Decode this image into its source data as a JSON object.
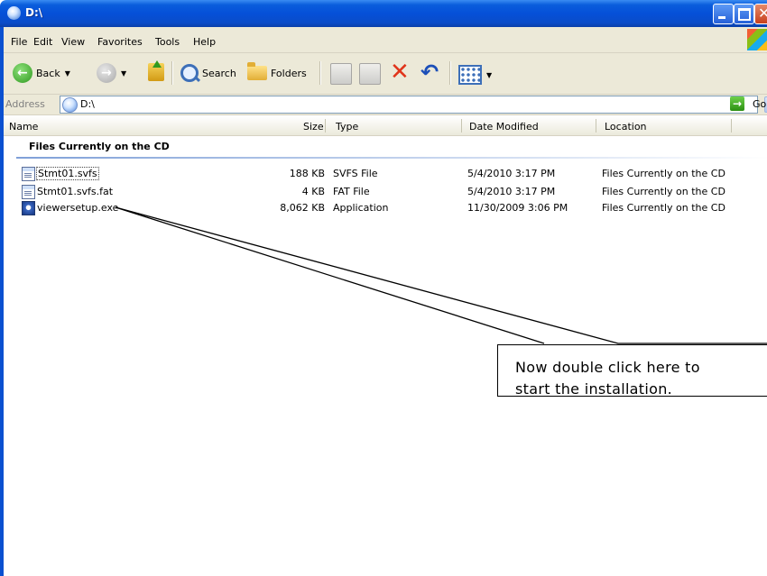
{
  "window": {
    "title": "D:\\",
    "colors": {
      "titlebar": "#0a5ddc",
      "chrome": "#ece9d8",
      "close": "#c8401c"
    }
  },
  "menu": {
    "items": [
      "File",
      "Edit",
      "View",
      "Favorites",
      "Tools",
      "Help"
    ]
  },
  "toolbar": {
    "back_label": "Back",
    "search_label": "Search",
    "folders_label": "Folders"
  },
  "address": {
    "label": "Address",
    "value": "D:\\",
    "go_label": "Go"
  },
  "columns": {
    "name": "Name",
    "size": "Size",
    "type": "Type",
    "date": "Date Modified",
    "location": "Location"
  },
  "group": {
    "title": "Files Currently on the CD"
  },
  "files": [
    {
      "name": "Stmt01.svfs",
      "size": "188 KB",
      "type": "SVFS File",
      "date": "5/4/2010 3:17 PM",
      "location": "Files Currently on the CD",
      "icon": "document-icon"
    },
    {
      "name": "Stmt01.svfs.fat",
      "size": "4 KB",
      "type": "FAT File",
      "date": "5/4/2010 3:17 PM",
      "location": "Files Currently on the CD",
      "icon": "document-icon"
    },
    {
      "name": "viewersetup.exe",
      "size": "8,062 KB",
      "type": "Application",
      "date": "11/30/2009 3:06 PM",
      "location": "Files Currently on the CD",
      "icon": "application-icon"
    }
  ],
  "callout": {
    "line1": "Now double click here to",
    "line2": "start the installation."
  }
}
